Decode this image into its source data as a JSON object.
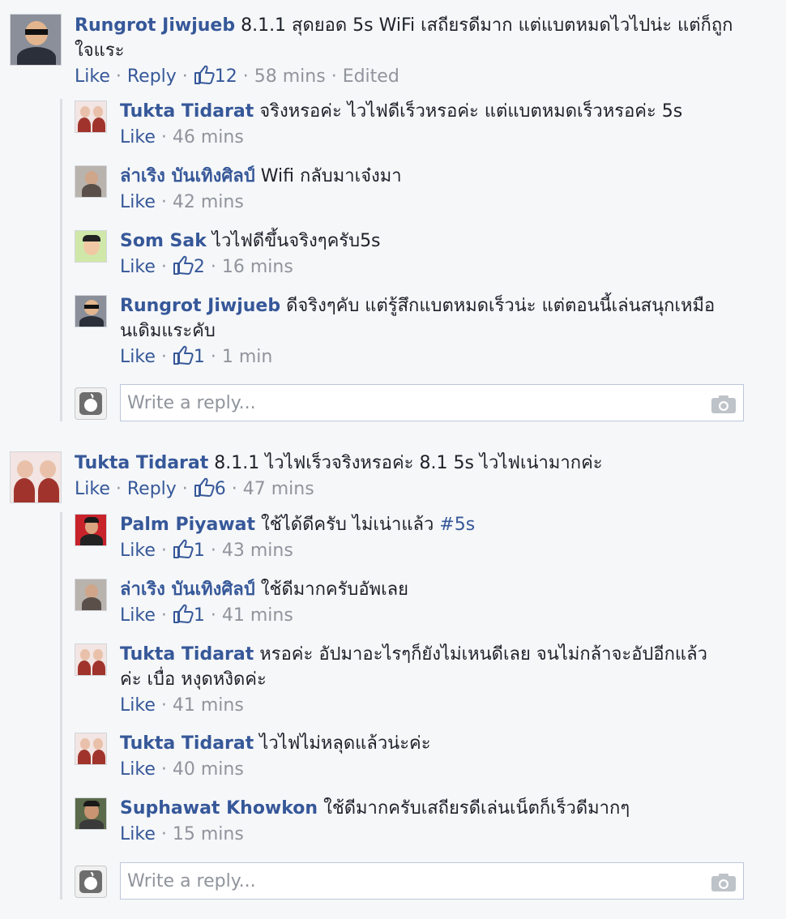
{
  "actions": {
    "like": "Like",
    "reply": "Reply",
    "sep": " · "
  },
  "threads": [
    {
      "top": {
        "author": "Rungrot Jiwjueb",
        "text": "8.1.1 สุดยอด 5s WiFi เสถียรดีมาก แต่แบตหมดไวไปน่ะ แต่ก็ถูก",
        "text2": "ใจแระ",
        "likes": "12",
        "time": "58 mins",
        "edited": "Edited"
      },
      "replies": [
        {
          "author": "Tukta Tidarat",
          "text": "จริงหรอค่ะ ไวไฟดีเร็วหรอค่ะ แต่แบตหมดเร็วหรอค่ะ 5s",
          "time": "46 mins"
        },
        {
          "author": "ล่าเริง บันเทิงศิลป์",
          "text": "Wifi กลับมาเจ๋งมา",
          "time": "42 mins"
        },
        {
          "author": "Som Sak",
          "text": "ไวไฟดีขึ้นจริงๆครับ5s",
          "likes": "2",
          "time": "16 mins"
        },
        {
          "author": "Rungrot Jiwjueb",
          "text": "ดีจริงๆคับ แต่รู้สึกแบตหมดเร็วน่ะ แต่ตอนนี้เล่นสนุกเหมือ",
          "text2": "นเดิมแระคับ",
          "likes": "1",
          "time": "1 min"
        }
      ],
      "reply_placeholder": "Write a reply..."
    },
    {
      "top": {
        "author": "Tukta Tidarat",
        "text": "8.1.1 ไวไฟเร็วจริงหรอค่ะ 8.1 5s ไวไฟเน่ามากค่ะ",
        "likes": "6",
        "time": "47 mins"
      },
      "replies": [
        {
          "author": "Palm Piyawat",
          "text": "ใช้ได้ดีครับ ไม่เน่าแล้ว",
          "hashtag": "#5s",
          "likes": "1",
          "time": "43 mins"
        },
        {
          "author": "ล่าเริง บันเทิงศิลป์",
          "text": "ใช้ดีมากครับอัพเลย",
          "likes": "1",
          "time": "41 mins"
        },
        {
          "author": "Tukta Tidarat",
          "text": "หรอค่ะ อัปมาอะไรๆก็ยังไม่เหนดีเลย จนไม่กล้าจะอัปอีกแล้ว",
          "text2": "ค่ะ เบื่อ หงุดหงิดค่ะ",
          "time": "41 mins"
        },
        {
          "author": "Tukta Tidarat",
          "text": "ไวไฟไม่หลุดแล้วน่ะค่ะ",
          "time": "40 mins"
        },
        {
          "author": "Suphawat Khowkon",
          "text": "ใช้ดีมากครับเสถียรดีเล่นเน็ตก็เร็วดีมากๆ",
          "time": "15 mins"
        }
      ],
      "reply_placeholder": "Write a reply..."
    }
  ]
}
